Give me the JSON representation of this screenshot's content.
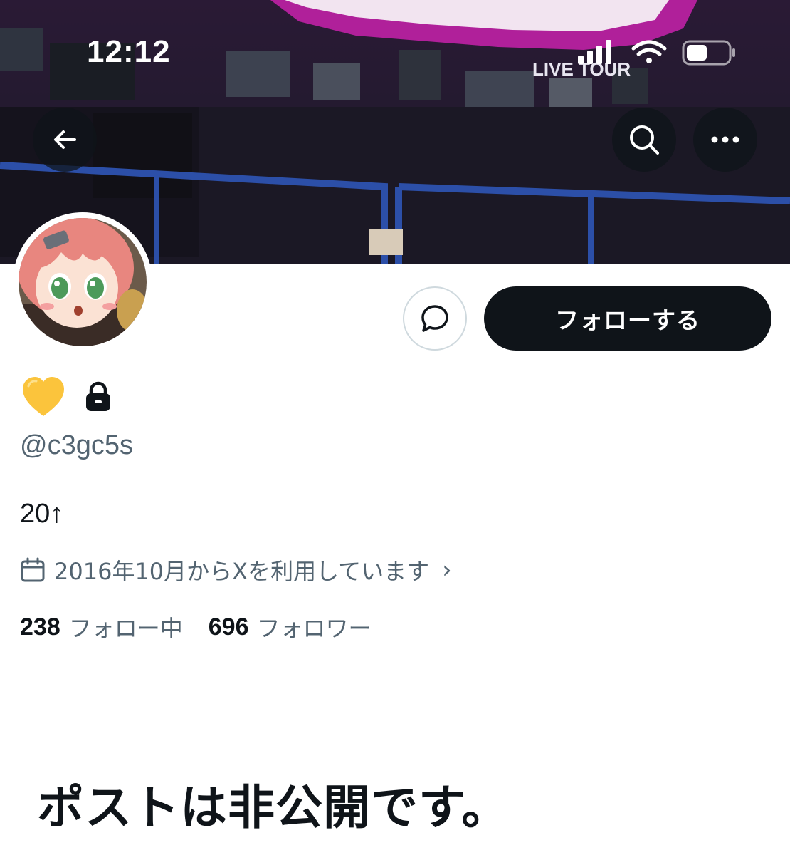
{
  "status_bar": {
    "time": "12:12"
  },
  "banner": {
    "stage_sign": "LIVE TOUR",
    "accent_color": "#b0209a"
  },
  "header": {
    "back_icon": "arrow-left-icon",
    "search_icon": "search-icon",
    "more_icon": "more-horizontal-icon"
  },
  "profile": {
    "avatar_icon": "avatar-anime-girl",
    "name_emoji": "yellow-heart-icon",
    "protected_icon": "lock-icon",
    "handle": "@c3gc5s",
    "bio": "20↑",
    "joined": "2016年10月からXを利用しています",
    "following_count": "238",
    "following_label": "フォロー中",
    "followers_count": "696",
    "followers_label": "フォロワー"
  },
  "actions": {
    "message_icon": "message-bubble-icon",
    "follow_label": "フォローする"
  },
  "content": {
    "private_notice": "ポストは非公開です。"
  },
  "colors": {
    "text_primary": "#0f1419",
    "text_secondary": "#536471",
    "button_dark": "#0f1419",
    "border": "#cfd9de"
  }
}
